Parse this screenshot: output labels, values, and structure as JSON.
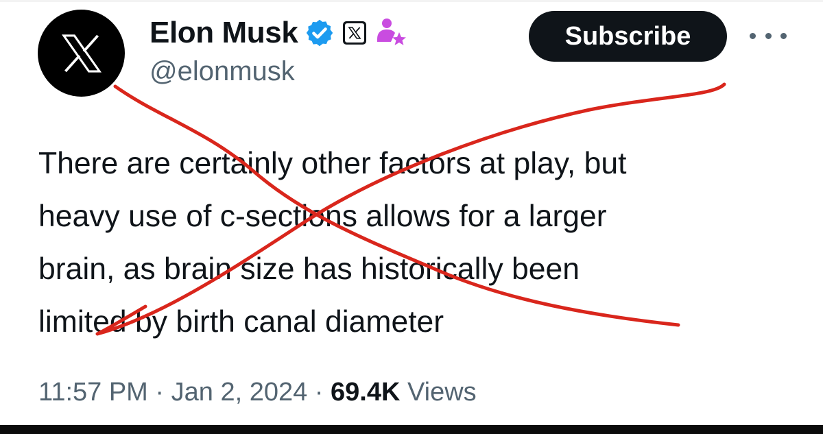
{
  "author": {
    "display_name": "Elon Musk",
    "handle": "@elonmusk",
    "verified_color": "#1d9bf0",
    "subscriber_icon_color": "#c94ce0",
    "affiliate_badge": "x-logo-badge"
  },
  "header": {
    "subscribe_label": "Subscribe",
    "more_icon": "more-horizontal-icon"
  },
  "tweet": {
    "lines": [
      "There are certainly other factors at play, but",
      "heavy use of c-sections allows for a larger",
      "brain, as brain size has historically been",
      "limited by birth canal diameter"
    ]
  },
  "meta": {
    "time": "11:57 PM",
    "separator": " · ",
    "date": "Jan 2, 2024",
    "views_count": "69.4K",
    "views_label": " Views"
  },
  "overlay": {
    "cross_color": "#d9261c"
  }
}
